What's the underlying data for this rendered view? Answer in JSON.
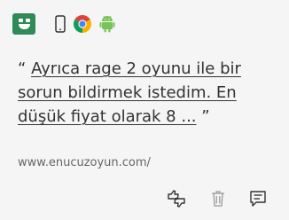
{
  "card": {
    "brand_icon": "smiley-logo-icon",
    "platform_icons": [
      "mobile-phone-icon",
      "chrome-icon",
      "android-icon"
    ],
    "quote": {
      "open_mark": "“",
      "text": "Ayrıca rage 2 oyunu ile bir sorun bildirmek istedim. En düşük fiyat olarak 8 ...",
      "close_mark": "”"
    },
    "source_url": "www.enucuzoyun.com/",
    "actions": [
      {
        "icon": "thumbs-up-down-icon"
      },
      {
        "icon": "trash-icon"
      },
      {
        "icon": "comment-icon"
      }
    ]
  },
  "colors": {
    "background": "#f5f5f5",
    "brand": "#2e8b57",
    "text": "#333333",
    "muted": "#666666"
  }
}
